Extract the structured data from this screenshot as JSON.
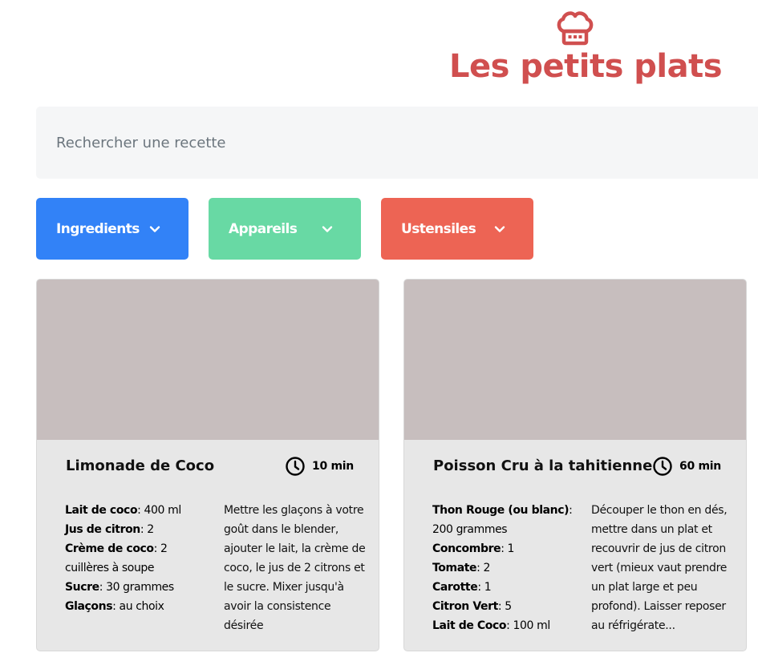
{
  "header": {
    "title": "Les petits plats",
    "logo_icon": "chef-hat-icon"
  },
  "search": {
    "placeholder": "Rechercher une recette",
    "value": ""
  },
  "filters": [
    {
      "label": "Ingredients",
      "color": "#3282f7",
      "icon": "chevron-down-icon"
    },
    {
      "label": "Appareils",
      "color": "#68d9a4",
      "icon": "chevron-down-icon"
    },
    {
      "label": "Ustensiles",
      "color": "#ed6454",
      "icon": "chevron-down-icon"
    }
  ],
  "recipes": [
    {
      "title": "Limonade de Coco",
      "time": "10 min",
      "ingredients": [
        {
          "name": "Lait de coco",
          "qty": ": 400 ml"
        },
        {
          "name": "Jus de citron",
          "qty": ": 2"
        },
        {
          "name": "Crème de coco",
          "qty": ": 2 cuillères à soupe"
        },
        {
          "name": "Sucre",
          "qty": ": 30 grammes"
        },
        {
          "name": "Glaçons",
          "qty": ": au choix"
        }
      ],
      "description": "Mettre les glaçons à votre goût dans le blender, ajouter le lait, la crème de coco, le jus de 2 citrons et le sucre. Mixer jusqu'à avoir la consistence désirée"
    },
    {
      "title": "Poisson Cru à la tahitienne",
      "time": "60 min",
      "ingredients": [
        {
          "name": "Thon Rouge (ou blanc)",
          "qty": ": 200 grammes"
        },
        {
          "name": "Concombre",
          "qty": ": 1"
        },
        {
          "name": "Tomate",
          "qty": ": 2"
        },
        {
          "name": "Carotte",
          "qty": ": 1"
        },
        {
          "name": "Citron Vert",
          "qty": ": 5"
        },
        {
          "name": "Lait de Coco",
          "qty": ": 100 ml"
        }
      ],
      "description": "Découper le thon en dés, mettre dans un plat et recouvrir de jus de citron vert (mieux vaut prendre un plat large et peu profond). Laisser reposer au réfrigérate..."
    }
  ]
}
